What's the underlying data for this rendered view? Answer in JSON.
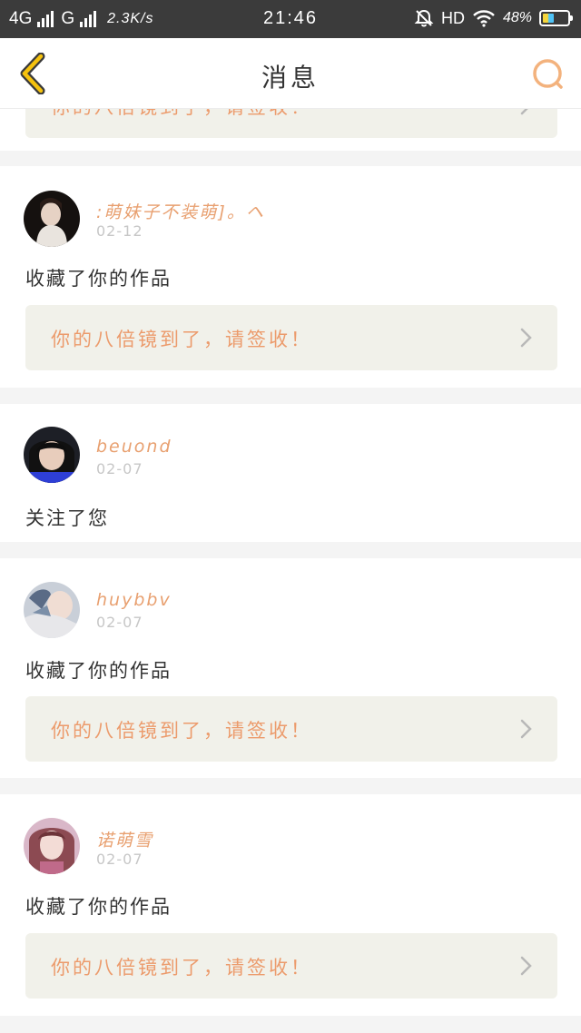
{
  "status_bar": {
    "net1": "4G",
    "net2": "G",
    "speed": "2.3K/s",
    "time": "21:46",
    "hd": "HD",
    "battery": "48%",
    "battery_level": 0.48
  },
  "header": {
    "title": "消息",
    "back_icon": "chevron-left-icon",
    "search_icon": "search-icon",
    "accent": "#f0a020"
  },
  "partial_bonus_text": "你的八倍镜到了，请签收！",
  "notifications": [
    {
      "user": ":萌妹子不装萌]。ヘ",
      "date": "02-12",
      "action": "收藏了你的作品",
      "bonus": "你的八倍镜到了，请签收！"
    },
    {
      "user": "beuond",
      "date": "02-07",
      "action": "关注了您"
    },
    {
      "user": "huybbv",
      "date": "02-07",
      "action": "收藏了你的作品",
      "bonus": "你的八倍镜到了，请签收！"
    },
    {
      "user": "诺萌雪",
      "date": "02-07",
      "action": "收藏了你的作品",
      "bonus": "你的八倍镜到了，请签收！"
    }
  ],
  "colors": {
    "username": "#e8a070",
    "bonus_text": "#ec9b6c",
    "bonus_bg": "#f1f1ea",
    "date": "#c7c7c7"
  }
}
